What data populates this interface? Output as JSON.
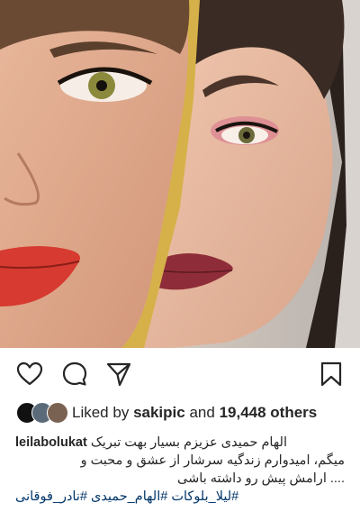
{
  "post": {
    "photo_icon": "two-faces-photo",
    "actions": {
      "like_icon": "heart-icon",
      "comment_icon": "comment-icon",
      "share_icon": "send-icon",
      "save_icon": "bookmark-icon"
    },
    "likes": {
      "prefix": "Liked by",
      "user": "sakipic",
      "and": "and",
      "count": "19,448 others"
    },
    "caption": {
      "username": "leilabolukat",
      "line1": "الهام حمیدی عزیزم بسیار بهت تبریک",
      "line2": "میگم، امیدوارم زندگیه سرشار از عشق و محبت و",
      "line3": ".... ارامش پیش رو داشته باشی",
      "hashtags": [
        "#لیلا_بلوکات",
        "#الهام_حمیدی",
        "#نادر_فوقانی"
      ]
    },
    "colors": {
      "hashtag": "#003569",
      "text": "#262626"
    }
  }
}
